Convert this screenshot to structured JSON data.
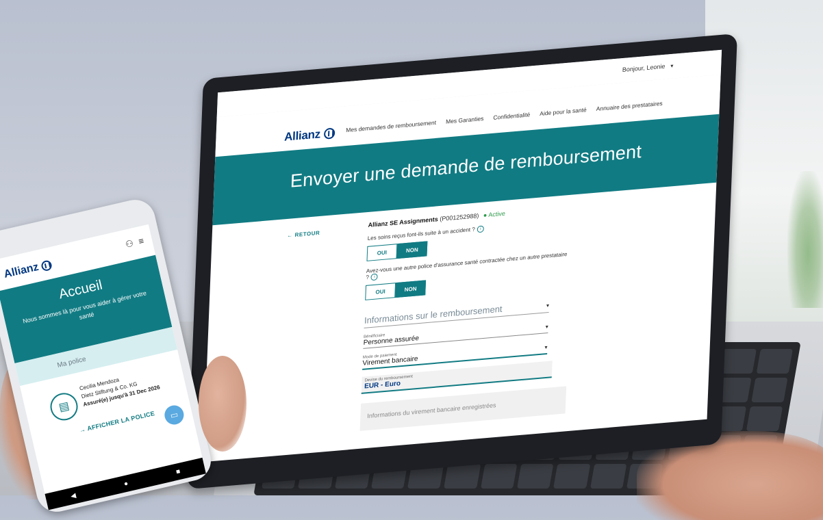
{
  "laptop": {
    "user_menu": "Bonjour, Leonie",
    "logo": "Allianz",
    "nav": [
      "Mes demandes de remboursement",
      "Mes Garanties",
      "Confidentialité",
      "Aide pour la santé",
      "Annuaire des prestataires"
    ],
    "hero_title": "Envoyer une demande de remboursement",
    "back": "RETOUR",
    "policy_name": "Allianz SE Assignments",
    "policy_id": "(P001252988)",
    "policy_status": "Active",
    "q1": "Les soins reçus font-ils suite à un accident ?",
    "q2": "Avez-vous une autre police d'assurance santé contractée chez un autre prestataire ?",
    "oui": "OUI",
    "non": "NON",
    "section_title": "Informations sur le remboursement",
    "fields": [
      {
        "label": "Bénéficiaire",
        "value": "Personne assurée"
      },
      {
        "label": "Mode de paiement",
        "value": "Virement bancaire"
      },
      {
        "label": "Devise du remboursement",
        "value": "EUR - Euro"
      }
    ],
    "bank_info": "Informations du virement bancaire enregistrées"
  },
  "phone": {
    "logo": "Allianz",
    "title": "Accueil",
    "subtitle": "Nous sommes là pour vous aider à gérer votre santé",
    "section": "Ma police",
    "holder": "Cecilia Mendoza",
    "company": "Dietz Stiftung & Co. KG",
    "insured_until": "Assuré(e) jusqu'à 31 Dec 2026",
    "link": "AFFICHER LA POLICE"
  },
  "colors": {
    "teal": "#117b83",
    "allianz_blue": "#003781"
  }
}
